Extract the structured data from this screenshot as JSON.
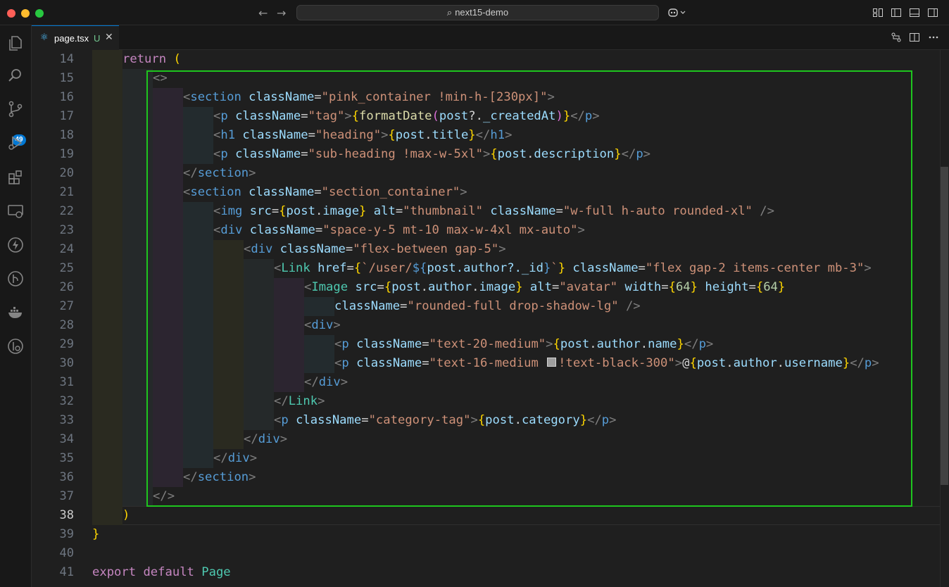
{
  "window": {
    "title": "next15-demo",
    "search_glyph": "⌕",
    "back_glyph": "←",
    "forward_glyph": "→"
  },
  "tab": {
    "filename": "page.tsx",
    "status": "U",
    "close_glyph": "✕",
    "icon_glyph": "⚛"
  },
  "activity": {
    "source_control_badge": "49"
  },
  "colors": {
    "highlight_border": "#1ec51e",
    "accent": "#0078d4"
  },
  "editor": {
    "active_line": "38",
    "lines": [
      {
        "n": "14",
        "code": "return ("
      },
      {
        "n": "15",
        "code": "<>"
      },
      {
        "n": "16",
        "code": "<section className=\"pink_container !min-h-[230px]\">"
      },
      {
        "n": "17",
        "code": "<p className=\"tag\">{formatDate(post?._createdAt)}</p>"
      },
      {
        "n": "18",
        "code": "<h1 className=\"heading\">{post.title}</h1>"
      },
      {
        "n": "19",
        "code": "<p className=\"sub-heading !max-w-5xl\">{post.description}</p>"
      },
      {
        "n": "20",
        "code": "</section>"
      },
      {
        "n": "21",
        "code": "<section className=\"section_container\">"
      },
      {
        "n": "22",
        "code": "<img src={post.image} alt=\"thumbnail\" className=\"w-full h-auto rounded-xl\" />"
      },
      {
        "n": "23",
        "code": "<div className=\"space-y-5 mt-10 max-w-4xl mx-auto\">"
      },
      {
        "n": "24",
        "code": "<div className=\"flex-between gap-5\">"
      },
      {
        "n": "25",
        "code": "<Link href={`/user/${post.author?._id}`} className=\"flex gap-2 items-center mb-3\">"
      },
      {
        "n": "26",
        "code": "<Image src={post.author.image} alt=\"avatar\" width={64} height={64}"
      },
      {
        "n": "27",
        "code": "className=\"rounded-full drop-shadow-lg\" />"
      },
      {
        "n": "28",
        "code": "<div>"
      },
      {
        "n": "29",
        "code": "<p className=\"text-20-medium\">{post.author.name}</p>"
      },
      {
        "n": "30",
        "code": "<p className=\"text-16-medium !text-black-300\">@{post.author.username}</p>"
      },
      {
        "n": "31",
        "code": "</div>"
      },
      {
        "n": "32",
        "code": "</Link>"
      },
      {
        "n": "33",
        "code": "<p className=\"category-tag\">{post.category}</p>"
      },
      {
        "n": "34",
        "code": "</div>"
      },
      {
        "n": "35",
        "code": "</div>"
      },
      {
        "n": "36",
        "code": "</section>"
      },
      {
        "n": "37",
        "code": "</>"
      },
      {
        "n": "38",
        "code": ")"
      },
      {
        "n": "39",
        "code": "}"
      },
      {
        "n": "40",
        "code": ""
      },
      {
        "n": "41",
        "code": "export default Page"
      }
    ]
  }
}
